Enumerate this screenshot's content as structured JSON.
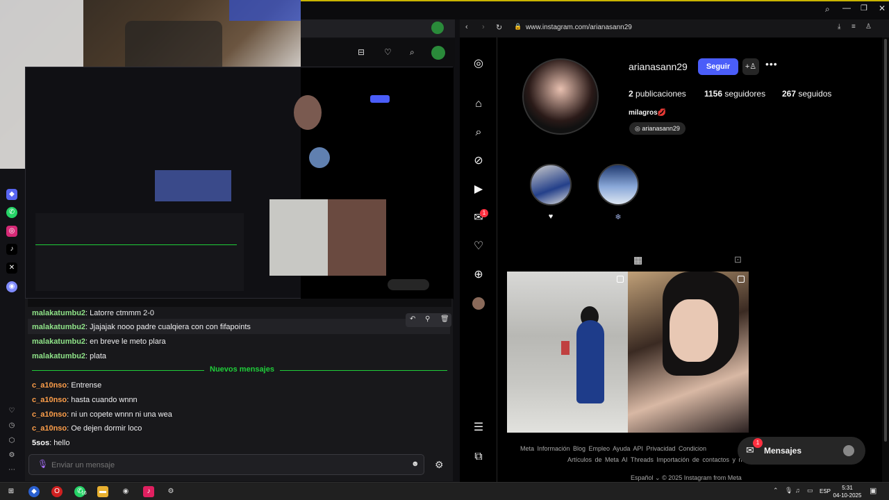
{
  "browser": {
    "url": "www.instagram.com/arianasann29"
  },
  "chat": {
    "messages": [
      {
        "user": "malakatumbu2",
        "text": ": Latorre ctmmm 2-0",
        "color": "#8fe388"
      },
      {
        "user": "malakatumbu2",
        "text": ": Jjajajak nooo padre cualqiera con con fifapoints",
        "color": "#8fe388"
      },
      {
        "user": "malakatumbu2",
        "text": ": en breve le meto plara",
        "color": "#8fe388"
      },
      {
        "user": "malakatumbu2",
        "text": ": plata",
        "color": "#8fe388"
      },
      {
        "user": "c_a10nso",
        "text": ": Entrense",
        "color": "#ff9f4a"
      },
      {
        "user": "c_a10nso",
        "text": ": hasta cuando wnnn",
        "color": "#ff9f4a"
      },
      {
        "user": "c_a10nso",
        "text": ": ni un copete wnnn ni una wea",
        "color": "#ff9f4a"
      },
      {
        "user": "c_a10nso",
        "text": ": Oe dejen dormir loco",
        "color": "#ff9f4a"
      },
      {
        "user": "5sos",
        "text": ": hello",
        "color": "#ffffff"
      }
    ],
    "new_messages_label": "Nuevos mensajes",
    "input_placeholder": "Enviar un mensaje"
  },
  "profile": {
    "username": "arianasann29",
    "follow_label": "Seguir",
    "more_label": "•••",
    "posts_count": "2",
    "posts_label": "publicaciones",
    "followers_count": "1156",
    "followers_label": "seguidores",
    "following_count": "267",
    "following_label": "seguidos",
    "full_name": "milagros💋",
    "threads_handle": "arianasann29",
    "highlights": [
      "♥",
      "❄"
    ]
  },
  "footer": {
    "line1": "Meta Información Blog Empleo Ayuda API Privacidad Condicion",
    "line2": "Artículos de Meta AI Threads Importación de contactos y no",
    "line3": "Español ⌄ © 2025 Instagram from Meta"
  },
  "messages_widget": {
    "label": "Mensajes",
    "badge": "1"
  },
  "notifications_badge": "1",
  "taskbar": {
    "language": "ESP",
    "time": "5:31",
    "date": "04-10-2025",
    "whatsapp_badge": "16"
  },
  "colors": {
    "accent": "#4a5df9",
    "chat_green": "#1fcf3a"
  }
}
